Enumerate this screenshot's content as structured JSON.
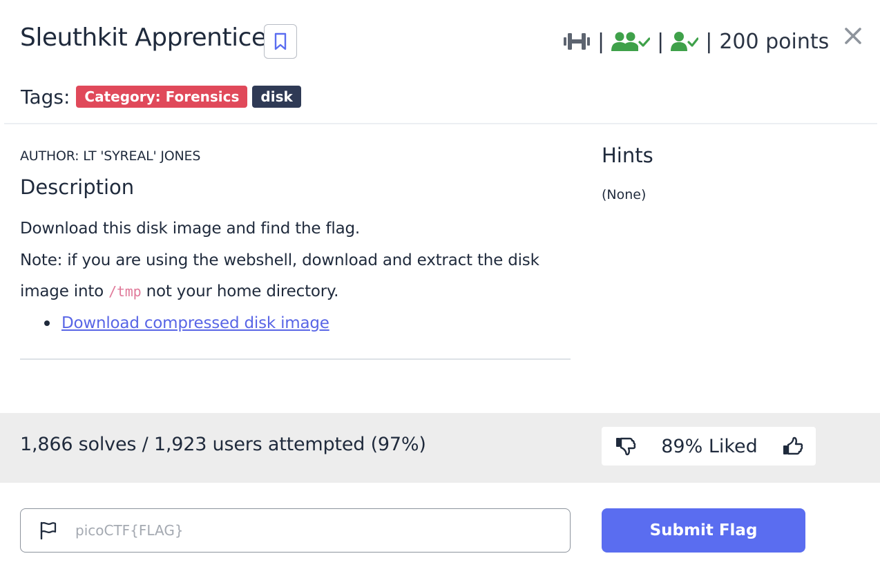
{
  "challenge": {
    "title": "Sleuthkit Apprentice",
    "points": "200 points",
    "separator": "|"
  },
  "tags": {
    "label": "Tags:",
    "items": [
      "Category: Forensics",
      "disk"
    ]
  },
  "description": {
    "author": "AUTHOR: LT 'SYREAL' JONES",
    "heading": "Description",
    "line1": "Download this disk image and find the flag.",
    "line2": "Note: if you are using the webshell, download and extract the disk",
    "line3_before": "image into ",
    "line3_code": "/tmp",
    "line3_after": " not your home directory.",
    "download_link": "Download compressed disk image"
  },
  "hints": {
    "heading": "Hints",
    "content": "(None)"
  },
  "stats": {
    "solves_text": "1,866 solves / 1,923 users attempted (97%)",
    "liked_text": "89% Liked"
  },
  "flag_form": {
    "placeholder": "picoCTF{FLAG}",
    "value": "",
    "submit_label": "Submit Flag"
  },
  "icons": {
    "difficulty": "dumbbell-icon",
    "solved_by_others": "users-check-icon",
    "solved_by_me": "user-check-icon",
    "bookmark": "bookmark-icon",
    "close": "close-icon",
    "dislike": "thumbs-down-icon",
    "like": "thumbs-up-icon",
    "flag": "flag-icon"
  },
  "colors": {
    "accent": "#5a6df0",
    "category_tag": "#e0495a",
    "disk_tag": "#2f3a55",
    "success_green": "#3fa14a",
    "difficulty_gray": "#5d6470",
    "close_gray": "#8e949c"
  }
}
